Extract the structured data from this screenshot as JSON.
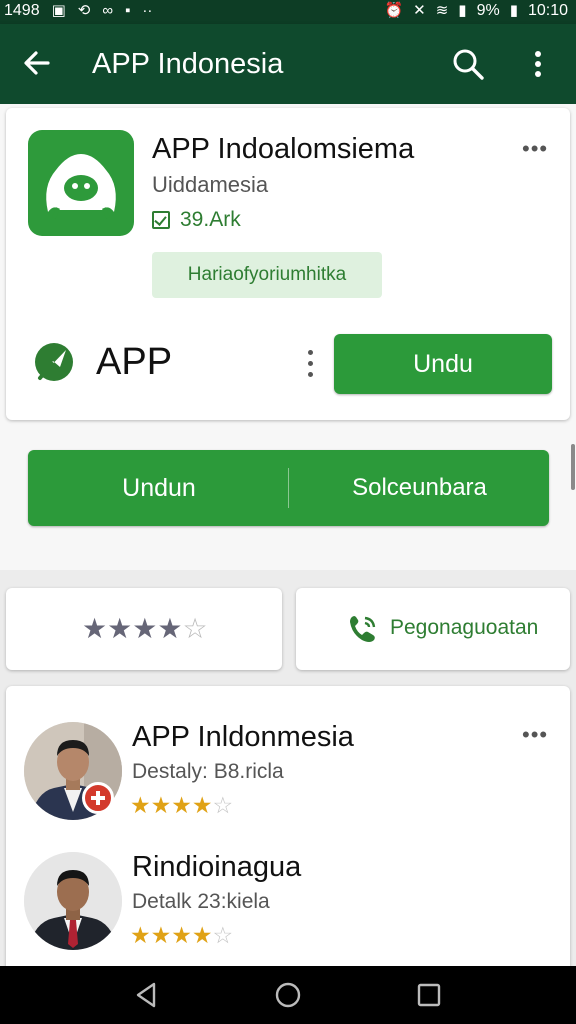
{
  "status_bar": {
    "time_left": "1498",
    "battery": "9%",
    "time": "10:10"
  },
  "app_bar": {
    "title": "APP Indonesia",
    "icons": [
      "arrow-back-icon",
      "search-icon",
      "more-vert-icon"
    ]
  },
  "app_card": {
    "name": "APP Indoalomsiema",
    "subtitle": "Uiddamesia",
    "size": "39.Ark",
    "badge": "Hariaofyoriumhitka",
    "publisher": "APP",
    "install_button": "Undu"
  },
  "split_buttons": {
    "left_label": "Undun",
    "right_label": "Solceunbara"
  },
  "rating_card": {
    "stars": 4,
    "max_stars": 5
  },
  "contact_card": {
    "label": "Pegonaguoatan"
  },
  "reviews": [
    {
      "name": "APP Inldonmesia",
      "meta": "Destaly:  B8.ricla",
      "stars": 4,
      "max_stars": 5
    },
    {
      "name": "Rindioinagua",
      "meta": "Detalk  23:kiela",
      "stars": 4,
      "max_stars": 5
    }
  ],
  "colors": {
    "app_bar": "#0f4a2d",
    "primary_green": "#2c9a3a",
    "star_gold": "#e0a216"
  }
}
